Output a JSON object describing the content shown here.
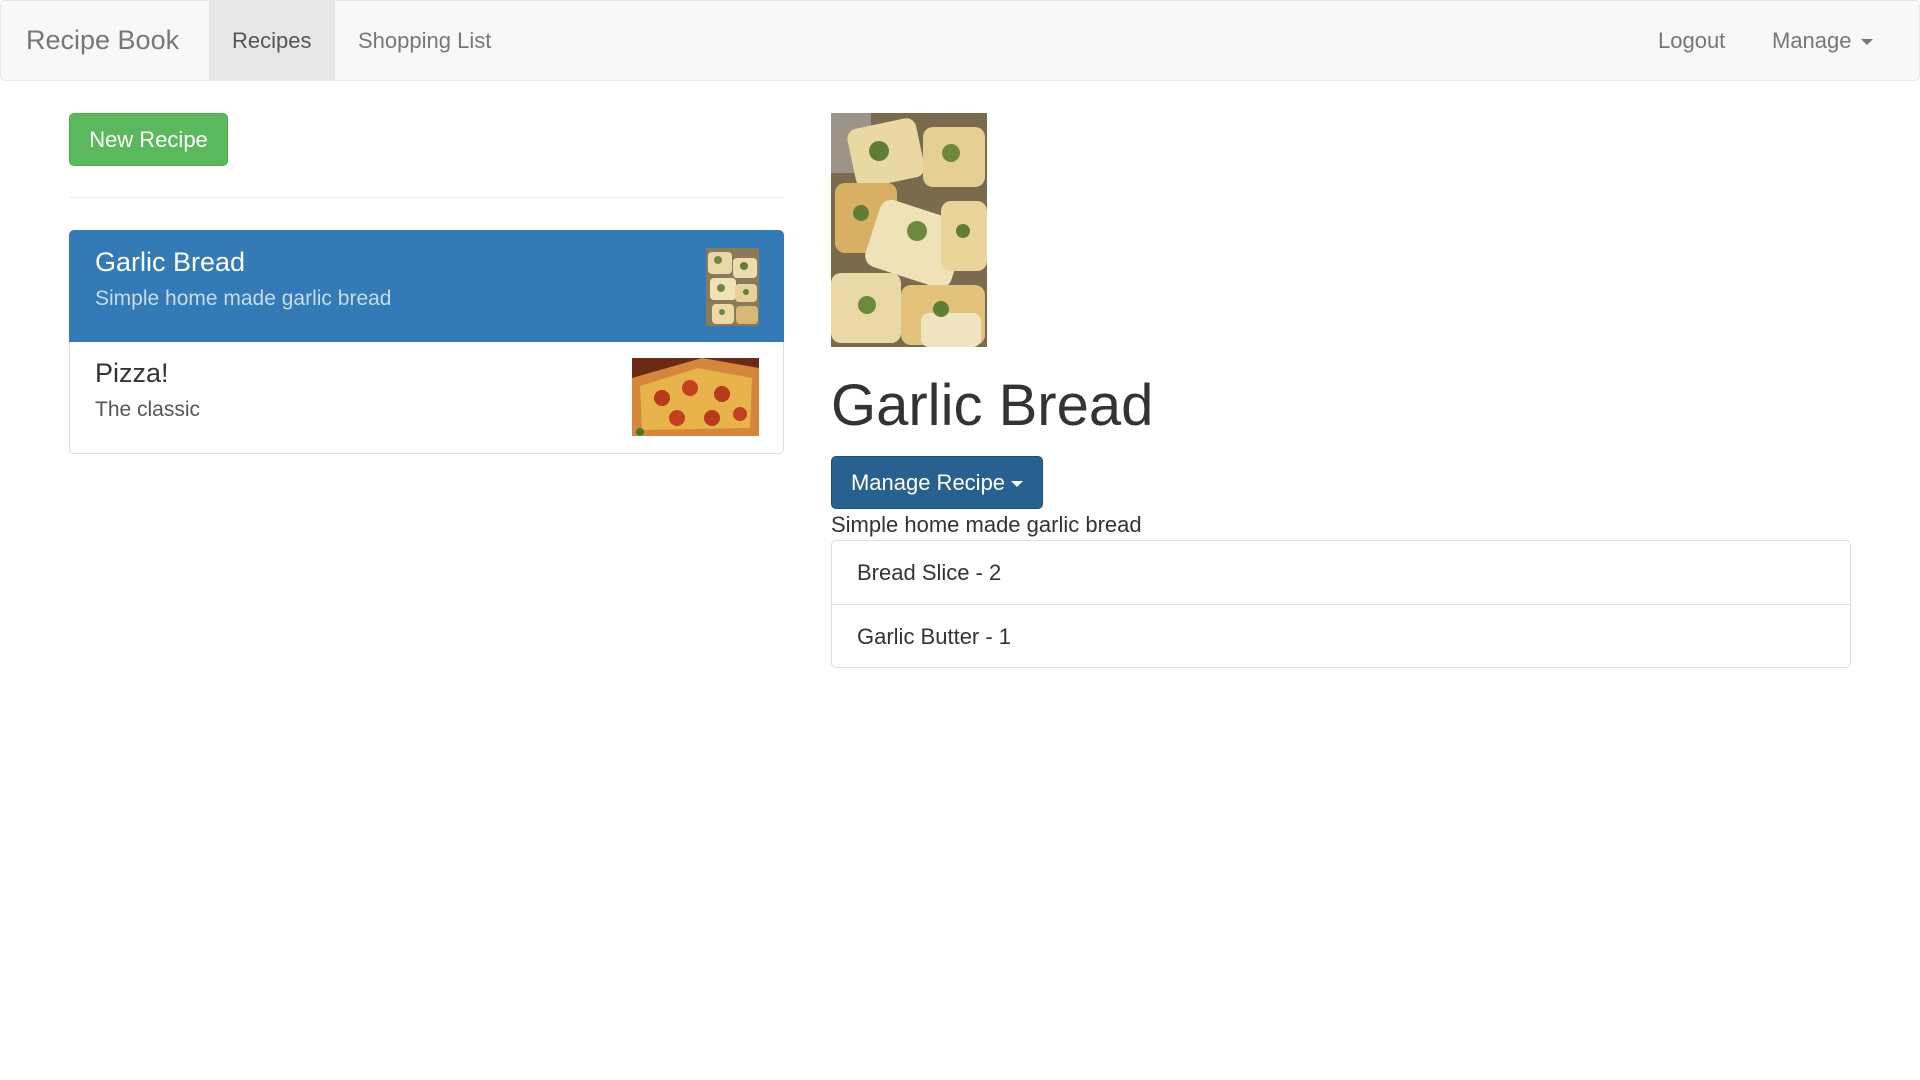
{
  "navbar": {
    "brand": "Recipe Book",
    "links": [
      {
        "label": "Recipes",
        "active": true
      },
      {
        "label": "Shopping List",
        "active": false
      }
    ],
    "logout_label": "Logout",
    "manage_label": "Manage"
  },
  "sidebar": {
    "new_recipe_label": "New Recipe",
    "recipes": [
      {
        "name": "Garlic Bread",
        "description": "Simple home made garlic bread",
        "active": true,
        "image": "garlic-bread-image"
      },
      {
        "name": "Pizza!",
        "description": "The classic",
        "active": false,
        "image": "pizza-image"
      }
    ]
  },
  "detail": {
    "image": "garlic-bread-image",
    "title": "Garlic Bread",
    "manage_label": "Manage Recipe",
    "description": "Simple home made garlic bread",
    "ingredients": [
      {
        "text": "Bread Slice - 2"
      },
      {
        "text": "Garlic Butter - 1"
      }
    ]
  },
  "colors": {
    "success": "#5cb85c",
    "primary": "#337ab7",
    "primary_dark": "#286090",
    "navbar_bg": "#f8f8f8"
  }
}
